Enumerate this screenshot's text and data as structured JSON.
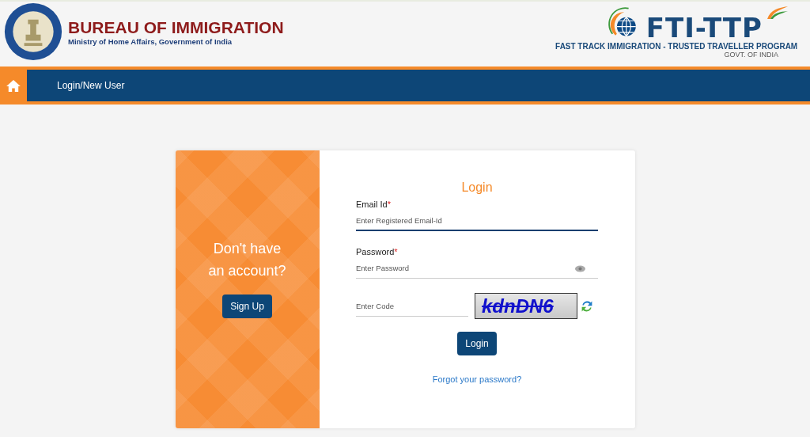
{
  "header": {
    "title": "BUREAU OF IMMIGRATION",
    "subtitle": "Ministry of Home Affairs, Government of India",
    "program_logo": "FTI-TTP",
    "program_name": "FAST TRACK IMMIGRATION - TRUSTED TRAVELLER PROGRAM",
    "program_owner": "GOVT. OF INDIA"
  },
  "nav": {
    "items": [
      {
        "label": "Login/New User"
      }
    ]
  },
  "signup_panel": {
    "text": "Don't have an account?",
    "button": "Sign Up"
  },
  "login": {
    "title": "Login",
    "fields": [
      {
        "kind": "email",
        "label": "Email Id",
        "required": true,
        "placeholder": "Enter Registered Email-Id",
        "focused": true
      },
      {
        "kind": "password",
        "label": "Password",
        "required": true,
        "placeholder": "Enter Password",
        "focused": false
      }
    ],
    "captcha": {
      "placeholder": "Enter Code",
      "code": "kdnDN6"
    },
    "button": "Login",
    "forgot_link": "Forgot your password?",
    "required_mark": "*"
  }
}
